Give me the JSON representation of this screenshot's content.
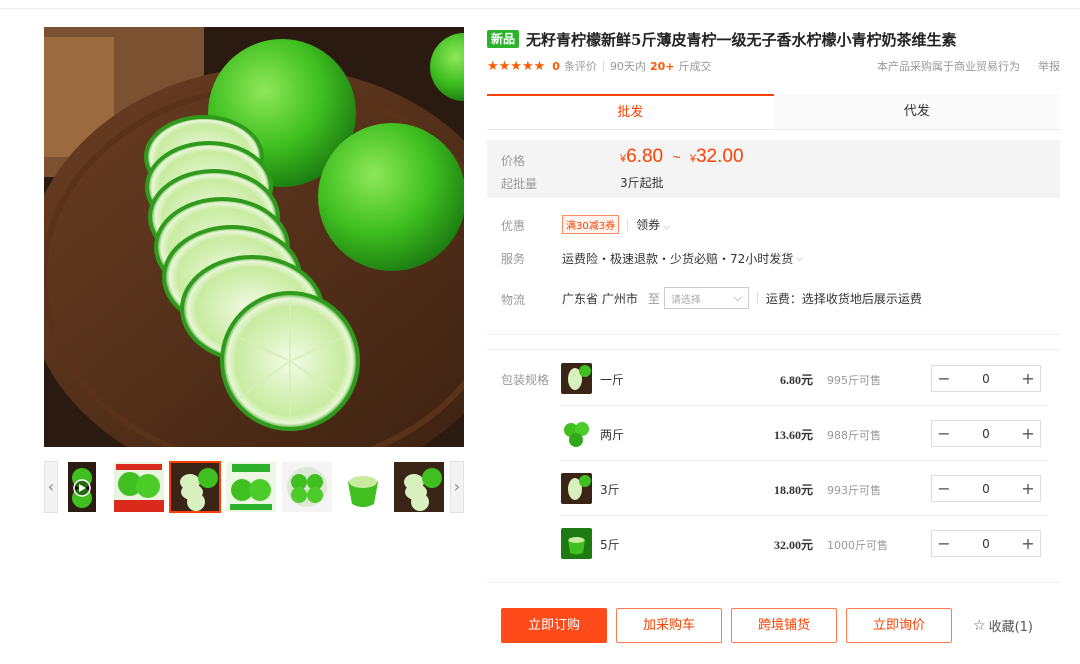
{
  "product": {
    "badge": "新品",
    "title": "无籽青柠檬新鲜5斤薄皮青柠一级无子香水柠檬小青柠奶茶维生素",
    "rating_stars": "★★★★★",
    "review_count": "0",
    "review_suffix": "条评价",
    "sales_period": "90天内",
    "sales_count": "20+",
    "sales_suffix": "斤成交",
    "purchase_note": "本产品采购属于商业贸易行为",
    "report": "举报"
  },
  "tabs": [
    "批发",
    "代发"
  ],
  "price": {
    "label": "价格",
    "currency": "¥",
    "low": "6.80",
    "tilde": "~",
    "high": "32.00",
    "moq_label": "起批量",
    "moq": "3斤起批"
  },
  "info": {
    "discount_label": "优惠",
    "coupon": "满30减3券",
    "get_coupon": "领券",
    "service_label": "服务",
    "services": "运费险・极速退款・少货必赔・72小时发货",
    "logistics_label": "物流",
    "origin": "广东省 广州市",
    "to": "至",
    "dest_placeholder": "请选择",
    "freight": "运费：选择收货地后展示运费"
  },
  "sku": {
    "label": "包装规格",
    "items": [
      {
        "name": "一斤",
        "price": "6.80元",
        "stock": "995斤可售",
        "qty": "0"
      },
      {
        "name": "两斤",
        "price": "13.60元",
        "stock": "988斤可售",
        "qty": "0"
      },
      {
        "name": "3斤",
        "price": "18.80元",
        "stock": "993斤可售",
        "qty": "0"
      },
      {
        "name": "5斤",
        "price": "32.00元",
        "stock": "1000斤可售",
        "qty": "0"
      }
    ]
  },
  "actions": {
    "order": "立即订购",
    "cart": "加采购车",
    "cross_border": "跨境铺货",
    "inquiry": "立即询价",
    "favorite": "收藏(1)"
  },
  "icons": {
    "prev": "chevron-left-icon",
    "next": "chevron-right-icon",
    "play": "play-icon",
    "star": "star-outline-icon"
  },
  "colors": {
    "accent": "#ff4000",
    "badge_green": "#2db22d",
    "star": "#ff5a00"
  }
}
